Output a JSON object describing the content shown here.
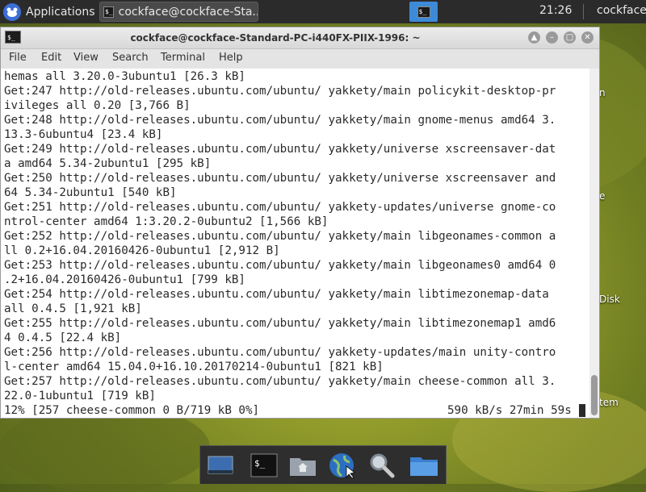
{
  "top_panel": {
    "apps_label": "Applications",
    "task_title": "cockface@cockface-Sta...",
    "clock": "21:26",
    "user": "cockface"
  },
  "desktop": {
    "labels": [
      "n",
      "e",
      "Disk",
      "tem"
    ]
  },
  "window": {
    "title": "cockface@cockface-Standard-PC-i440FX-PIIX-1996: ~",
    "controls": [
      "▲",
      "–",
      "□",
      "✕"
    ],
    "menu": [
      "File",
      "Edit",
      "View",
      "Search",
      "Terminal",
      "Help"
    ]
  },
  "terminal": {
    "lines": [
      "hemas all 3.20.0-3ubuntu1 [26.3 kB]",
      "Get:247 http://old-releases.ubuntu.com/ubuntu/ yakkety/main policykit-desktop-pr",
      "ivileges all 0.20 [3,766 B]",
      "Get:248 http://old-releases.ubuntu.com/ubuntu/ yakkety/main gnome-menus amd64 3.",
      "13.3-6ubuntu4 [23.4 kB]",
      "Get:249 http://old-releases.ubuntu.com/ubuntu/ yakkety/universe xscreensaver-dat",
      "a amd64 5.34-2ubuntu1 [295 kB]",
      "Get:250 http://old-releases.ubuntu.com/ubuntu/ yakkety/universe xscreensaver and",
      "64 5.34-2ubuntu1 [540 kB]",
      "Get:251 http://old-releases.ubuntu.com/ubuntu/ yakkety-updates/universe gnome-co",
      "ntrol-center amd64 1:3.20.2-0ubuntu2 [1,566 kB]",
      "Get:252 http://old-releases.ubuntu.com/ubuntu/ yakkety/main libgeonames-common a",
      "ll 0.2+16.04.20160426-0ubuntu1 [2,912 B]",
      "Get:253 http://old-releases.ubuntu.com/ubuntu/ yakkety/main libgeonames0 amd64 0",
      ".2+16.04.20160426-0ubuntu1 [799 kB]",
      "Get:254 http://old-releases.ubuntu.com/ubuntu/ yakkety/main libtimezonemap-data",
      "all 0.4.5 [1,921 kB]",
      "Get:255 http://old-releases.ubuntu.com/ubuntu/ yakkety/main libtimezonemap1 amd6",
      "4 0.4.5 [22.4 kB]",
      "Get:256 http://old-releases.ubuntu.com/ubuntu/ yakkety-updates/main unity-contro",
      "l-center amd64 15.04.0+16.10.20170214-0ubuntu1 [821 kB]",
      "Get:257 http://old-releases.ubuntu.com/ubuntu/ yakkety/main cheese-common all 3.",
      "22.0-1ubuntu1 [719 kB]"
    ],
    "status_left": "12% [257 cheese-common 0 B/719 kB 0%]",
    "status_right": "590 kB/s 27min 59s"
  },
  "dock": {
    "items": [
      "show-desktop-icon",
      "terminal-icon",
      "home-folder-icon",
      "web-browser-icon",
      "search-icon",
      "files-icon"
    ]
  }
}
